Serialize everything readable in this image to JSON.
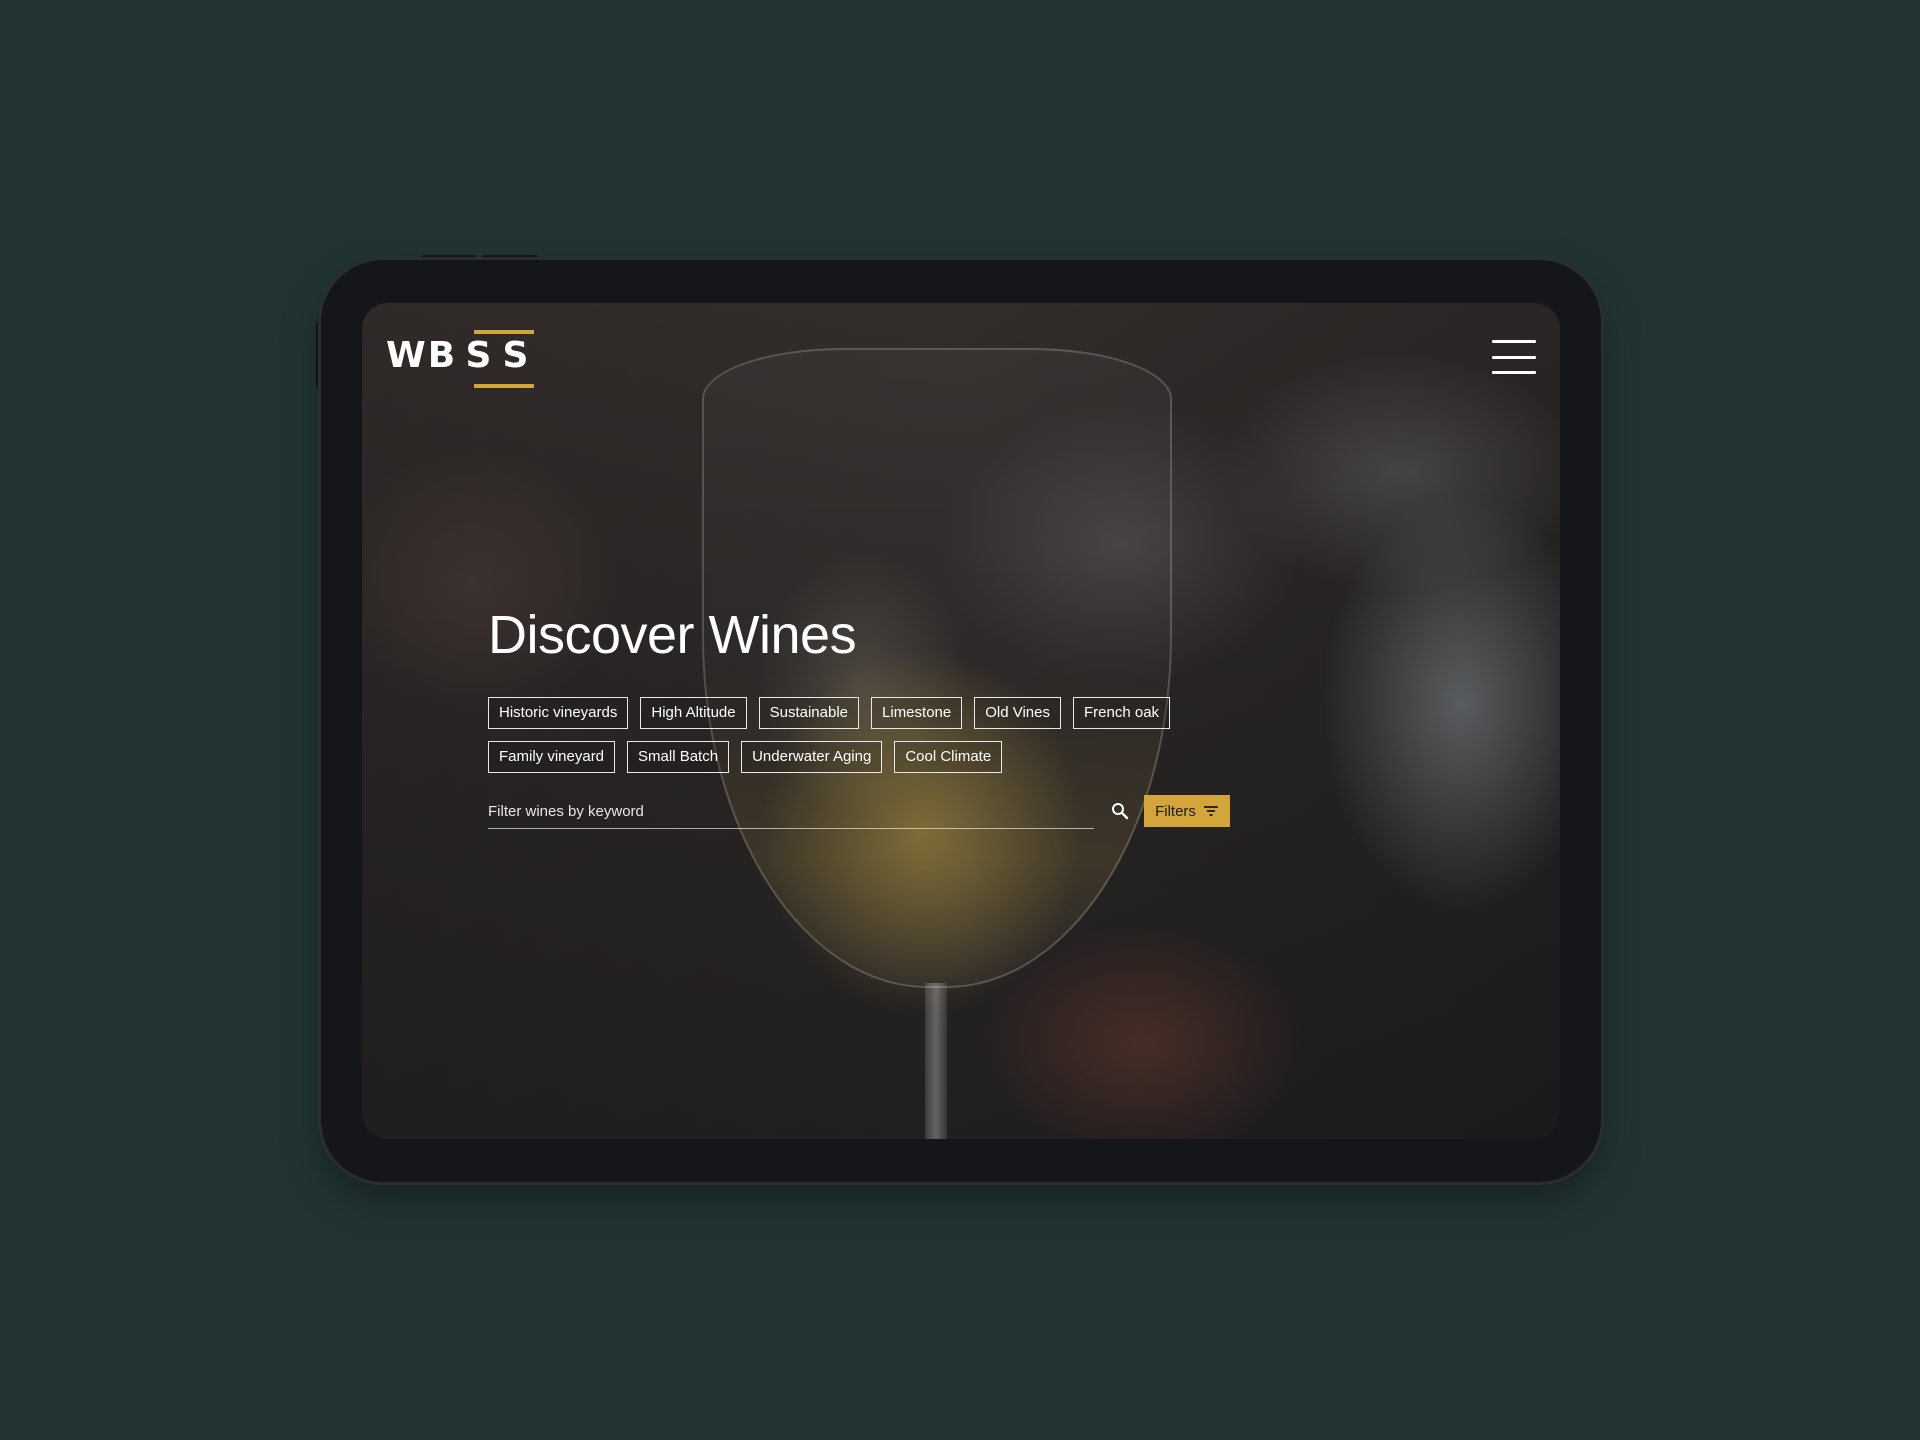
{
  "brand": {
    "letters": [
      "W",
      "B",
      "S",
      "S"
    ],
    "accent_color": "#d4a53b"
  },
  "header": {
    "menu_icon": "hamburger-menu-icon"
  },
  "hero": {
    "title": "Discover Wines",
    "tags": [
      "Historic vineyards",
      "High Altitude",
      "Sustainable",
      "Limestone",
      "Old Vines",
      "French oak",
      "Family vineyard",
      "Small Batch",
      "Underwater Aging",
      "Cool Climate"
    ]
  },
  "search": {
    "placeholder": "Filter wines by keyword",
    "value": "",
    "icon": "search-icon"
  },
  "filters": {
    "label": "Filters",
    "icon": "filter-lines-icon"
  },
  "colors": {
    "background": "#213433",
    "device": "#141619",
    "accent": "#d4a53b"
  }
}
